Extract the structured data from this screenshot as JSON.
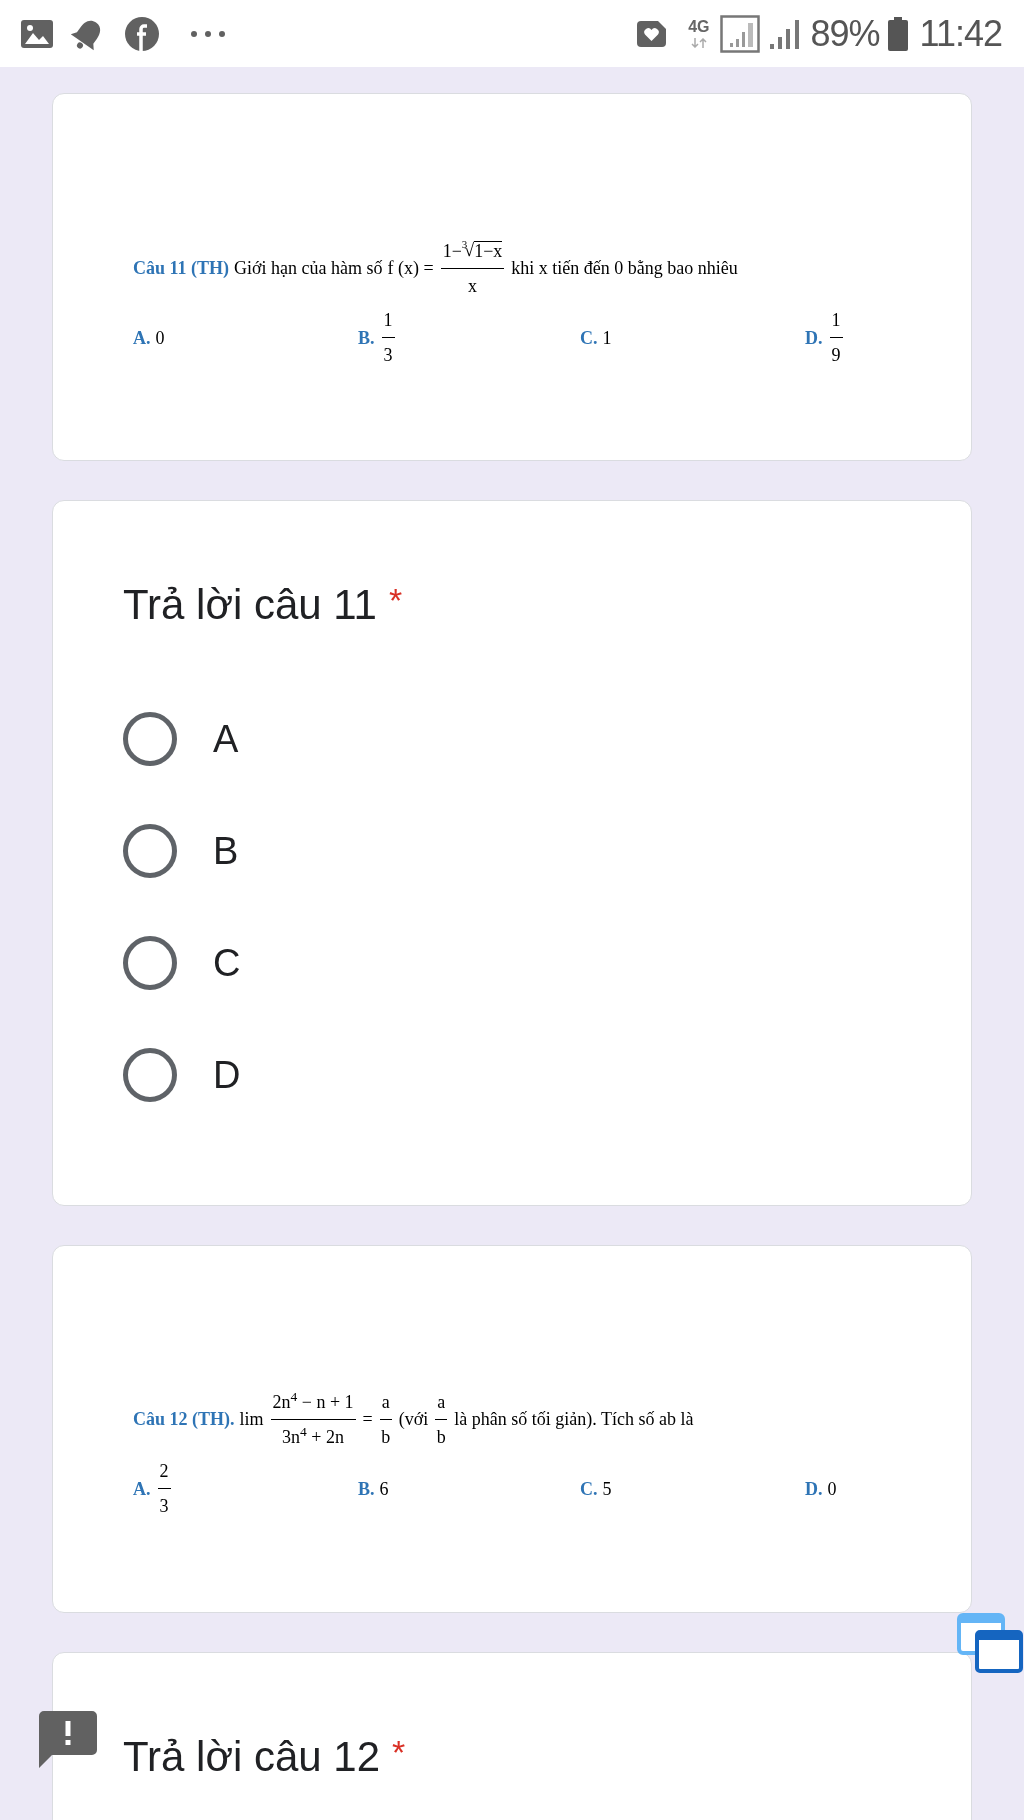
{
  "status_bar": {
    "network": "4G",
    "battery": "89%",
    "time": "11:42"
  },
  "cards": [
    {
      "kind": "question_image",
      "label": "Câu 11 (TH)",
      "content": [
        {
          "kind": "text",
          "text": "Giới hạn của hàm số"
        },
        {
          "kind": "text",
          "text": "f (x) ="
        },
        {
          "kind": "fraction",
          "numerator": [
            {
              "kind": "text",
              "text": "1−"
            },
            {
              "kind": "root",
              "index": "3",
              "sign": "√",
              "radicand": "1−x"
            }
          ],
          "denominator": [
            {
              "kind": "text",
              "text": "x"
            }
          ]
        },
        {
          "kind": "text",
          "text": "khi x tiến đến 0 bằng bao nhiêu"
        }
      ],
      "options": [
        {
          "letter": "A.",
          "kind": "text",
          "value": "0"
        },
        {
          "letter": "B.",
          "kind": "fraction",
          "numerator": "1",
          "denominator": "3"
        },
        {
          "letter": "C.",
          "kind": "text",
          "value": "1"
        },
        {
          "letter": "D.",
          "kind": "fraction",
          "numerator": "1",
          "denominator": "9"
        }
      ]
    },
    {
      "kind": "answer",
      "title": "Trả lời câu 11",
      "required_mark": "*",
      "choices": [
        {
          "label": "A",
          "selected": false
        },
        {
          "label": "B",
          "selected": false
        },
        {
          "label": "C",
          "selected": false
        },
        {
          "label": "D",
          "selected": false
        }
      ]
    },
    {
      "kind": "question_image",
      "label": "Câu 12 (TH).",
      "content": [
        {
          "kind": "text",
          "text": "lim"
        },
        {
          "kind": "fraction",
          "numerator": [
            {
              "kind": "text",
              "text": "2n$^{4}$ − n + 1"
            }
          ],
          "denominator": [
            {
              "kind": "text",
              "text": "3n$^{4}$ + 2n"
            }
          ]
        },
        {
          "kind": "text",
          "text": "="
        },
        {
          "kind": "fraction",
          "numerator": [
            {
              "kind": "text",
              "text": "a"
            }
          ],
          "denominator": [
            {
              "kind": "text",
              "text": "b"
            }
          ]
        },
        {
          "kind": "text",
          "text": "(với"
        },
        {
          "kind": "fraction",
          "numerator": [
            {
              "kind": "text",
              "text": "a"
            }
          ],
          "denominator": [
            {
              "kind": "text",
              "text": "b"
            }
          ]
        },
        {
          "kind": "text",
          "text": "là phân số tối giản). Tích số ab là"
        }
      ],
      "options": [
        {
          "letter": "A.",
          "kind": "fraction",
          "numerator": "2",
          "denominator": "3"
        },
        {
          "letter": "B.",
          "kind": "text",
          "value": "6"
        },
        {
          "letter": "C.",
          "kind": "text",
          "value": "5"
        },
        {
          "letter": "D.",
          "kind": "text",
          "value": "0"
        }
      ]
    },
    {
      "kind": "answer",
      "title": "Trả lời câu 12",
      "required_mark": "*"
    }
  ]
}
